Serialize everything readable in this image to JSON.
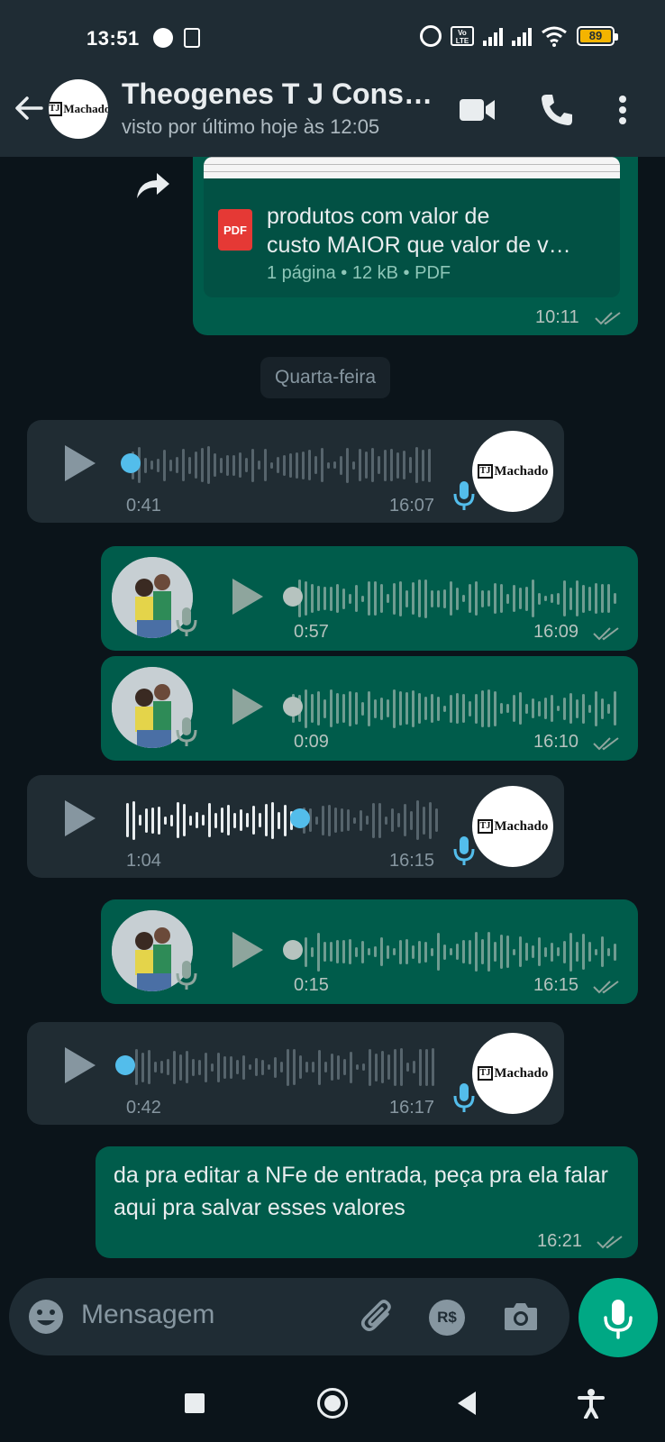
{
  "status_bar": {
    "time": "13:51",
    "battery": "89",
    "network_label": "Vo LTE"
  },
  "header": {
    "contact_name": "Theogenes T J Cons…",
    "last_seen": "visto por último hoje às 12:05",
    "avatar_logo": "Machado"
  },
  "messages": {
    "document": {
      "file_name_line1": "produtos com valor de",
      "file_name_line2": "custo MAIOR  que valor de v…",
      "meta": "1 página • 12 kB • PDF",
      "file_type_icon": "PDF",
      "time": "10:11"
    },
    "date_divider": "Quarta-feira",
    "voice_1": {
      "duration": "0:41",
      "time": "16:07",
      "direction": "incoming",
      "progress": 0.0
    },
    "voice_2": {
      "duration": "0:57",
      "time": "16:09",
      "direction": "outgoing",
      "progress": 0.0
    },
    "voice_3": {
      "duration": "0:09",
      "time": "16:10",
      "direction": "outgoing",
      "progress": 0.0
    },
    "voice_4": {
      "duration": "1:04",
      "time": "16:15",
      "direction": "incoming",
      "progress": 0.55
    },
    "voice_5": {
      "duration": "0:15",
      "time": "16:15",
      "direction": "outgoing",
      "progress": 0.0
    },
    "voice_6": {
      "duration": "0:42",
      "time": "16:17",
      "direction": "incoming",
      "progress": 0.0
    },
    "text_1": {
      "text": "da pra editar a NFe de entrada,  peça pra ela falar aqui pra salvar esses valores",
      "time": "16:21"
    }
  },
  "input": {
    "placeholder": "Mensagem",
    "currency_label": "R$"
  },
  "colors": {
    "outgoing_bubble": "#005c4b",
    "incoming_bubble": "#202c33",
    "accent": "#00a884",
    "played_blue": "#53bdeb"
  }
}
